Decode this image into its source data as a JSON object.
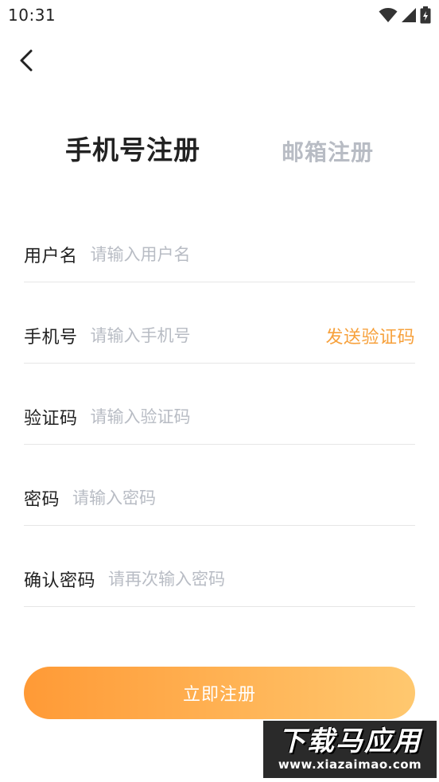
{
  "status_bar": {
    "time": "10:31",
    "icons": [
      "wifi-icon",
      "signal-icon",
      "battery-icon"
    ]
  },
  "header": {
    "back_icon": "chevron-left-icon"
  },
  "tabs": [
    {
      "label": "手机号注册",
      "active": true
    },
    {
      "label": "邮箱注册",
      "active": false
    }
  ],
  "form": {
    "username": {
      "label": "用户名",
      "placeholder": "请输入用户名",
      "value": ""
    },
    "phone": {
      "label": "手机号",
      "placeholder": "请输入手机号",
      "value": "",
      "action_label": "发送验证码"
    },
    "code": {
      "label": "验证码",
      "placeholder": "请输入验证码",
      "value": ""
    },
    "password": {
      "label": "密码",
      "placeholder": "请输入密码",
      "value": ""
    },
    "confirm_password": {
      "label": "确认密码",
      "placeholder": "请再次输入密码",
      "value": ""
    }
  },
  "submit": {
    "label": "立即注册"
  },
  "watermark": {
    "title": "下载马应用",
    "url": "www.xiazaimao.com"
  },
  "colors": {
    "accent": "#f7a13c",
    "button_gradient_start": "#ff9a36",
    "button_gradient_end": "#ffc86f",
    "placeholder": "#b8bcc4",
    "inactive_tab": "#b8bcc4",
    "text": "#222222",
    "divider": "#e6e6e6"
  }
}
